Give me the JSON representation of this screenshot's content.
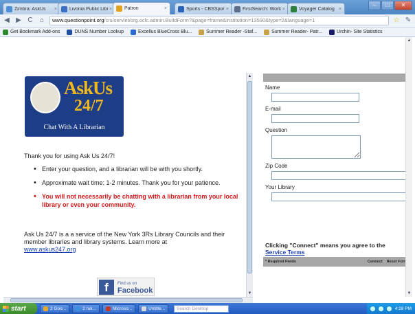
{
  "browser": {
    "tabs": [
      {
        "label": "Zimbra: AskUs",
        "color": "#4a8fd8"
      },
      {
        "label": "Livonia Public Librar",
        "color": "#3b6fc4"
      },
      {
        "label": "Patron",
        "color": "#e3a122",
        "active": true
      },
      {
        "label": "Sports - CBSSports",
        "color": "#2a63b8"
      },
      {
        "label": "FirstSearch: World",
        "color": "#5c6f8a"
      },
      {
        "label": "Voyager Catalog",
        "color": "#2f7f3f"
      }
    ],
    "url_domain": "www.questionpoint.org",
    "url_path": "/crs/servlet/org.oclc.admin.BuildForm?&page=frame&institution=13590&type=2&language=1",
    "bookmarks": [
      {
        "label": "Get Bookmark Add-ons",
        "color": "#2c8d2c"
      },
      {
        "label": "DUNS Number Lookup",
        "color": "#1f4f9f"
      },
      {
        "label": "Excellus BlueCross Blu...",
        "color": "#2b6bd1"
      },
      {
        "label": "Summer Reader -Staf...",
        "color": "#c7a24a"
      },
      {
        "label": "Summer Reader- Patr...",
        "color": "#c7a24a"
      },
      {
        "label": "Urchin- Site Statistics",
        "color": "#1a1a6a"
      }
    ]
  },
  "logo": {
    "line1": "AskUs",
    "line2": "24/7",
    "tagline": "Chat With A Librarian"
  },
  "intro": "Thank you for using Ask Us 24/7!",
  "bullets": [
    {
      "text": "Enter your question, and a librarian will be with you shortly.",
      "warn": false
    },
    {
      "text": "Approximate wait time: 1-2 minutes. Thank you for your patience.",
      "warn": false
    },
    {
      "text": "You will not necessarily be chatting with a librarian from your local library or even your community.",
      "warn": true
    }
  ],
  "about": {
    "text": "Ask Us 24/7 is a a service of the New York 3Rs Library Councils and their member libraries and library systems. Learn more at",
    "link": "www.askus247.org"
  },
  "facebook": {
    "small": "Find us on",
    "big": "Facebook"
  },
  "form": {
    "fields": {
      "name": "Name",
      "email": "E-mail",
      "question": "Question",
      "zip": "Zip Code",
      "library": "Your Library"
    },
    "agree_text": "Clicking \"Connect\" means you agree to the",
    "terms_link": "Service Terms",
    "required": "* Required Fields",
    "connect": "Connect",
    "reset": "Reset Form"
  },
  "taskbar": {
    "start": "start",
    "items": [
      {
        "label": "2 Goo...",
        "color": "#e6a72a"
      },
      {
        "label": "2 ruk...",
        "color": "#3a8fe0"
      },
      {
        "label": "Microso...",
        "color": "#c9372c"
      },
      {
        "label": "Untitle...",
        "color": "#d9d9d9"
      }
    ],
    "search_placeholder": "Search Desktop",
    "clock": "4:28 PM"
  }
}
